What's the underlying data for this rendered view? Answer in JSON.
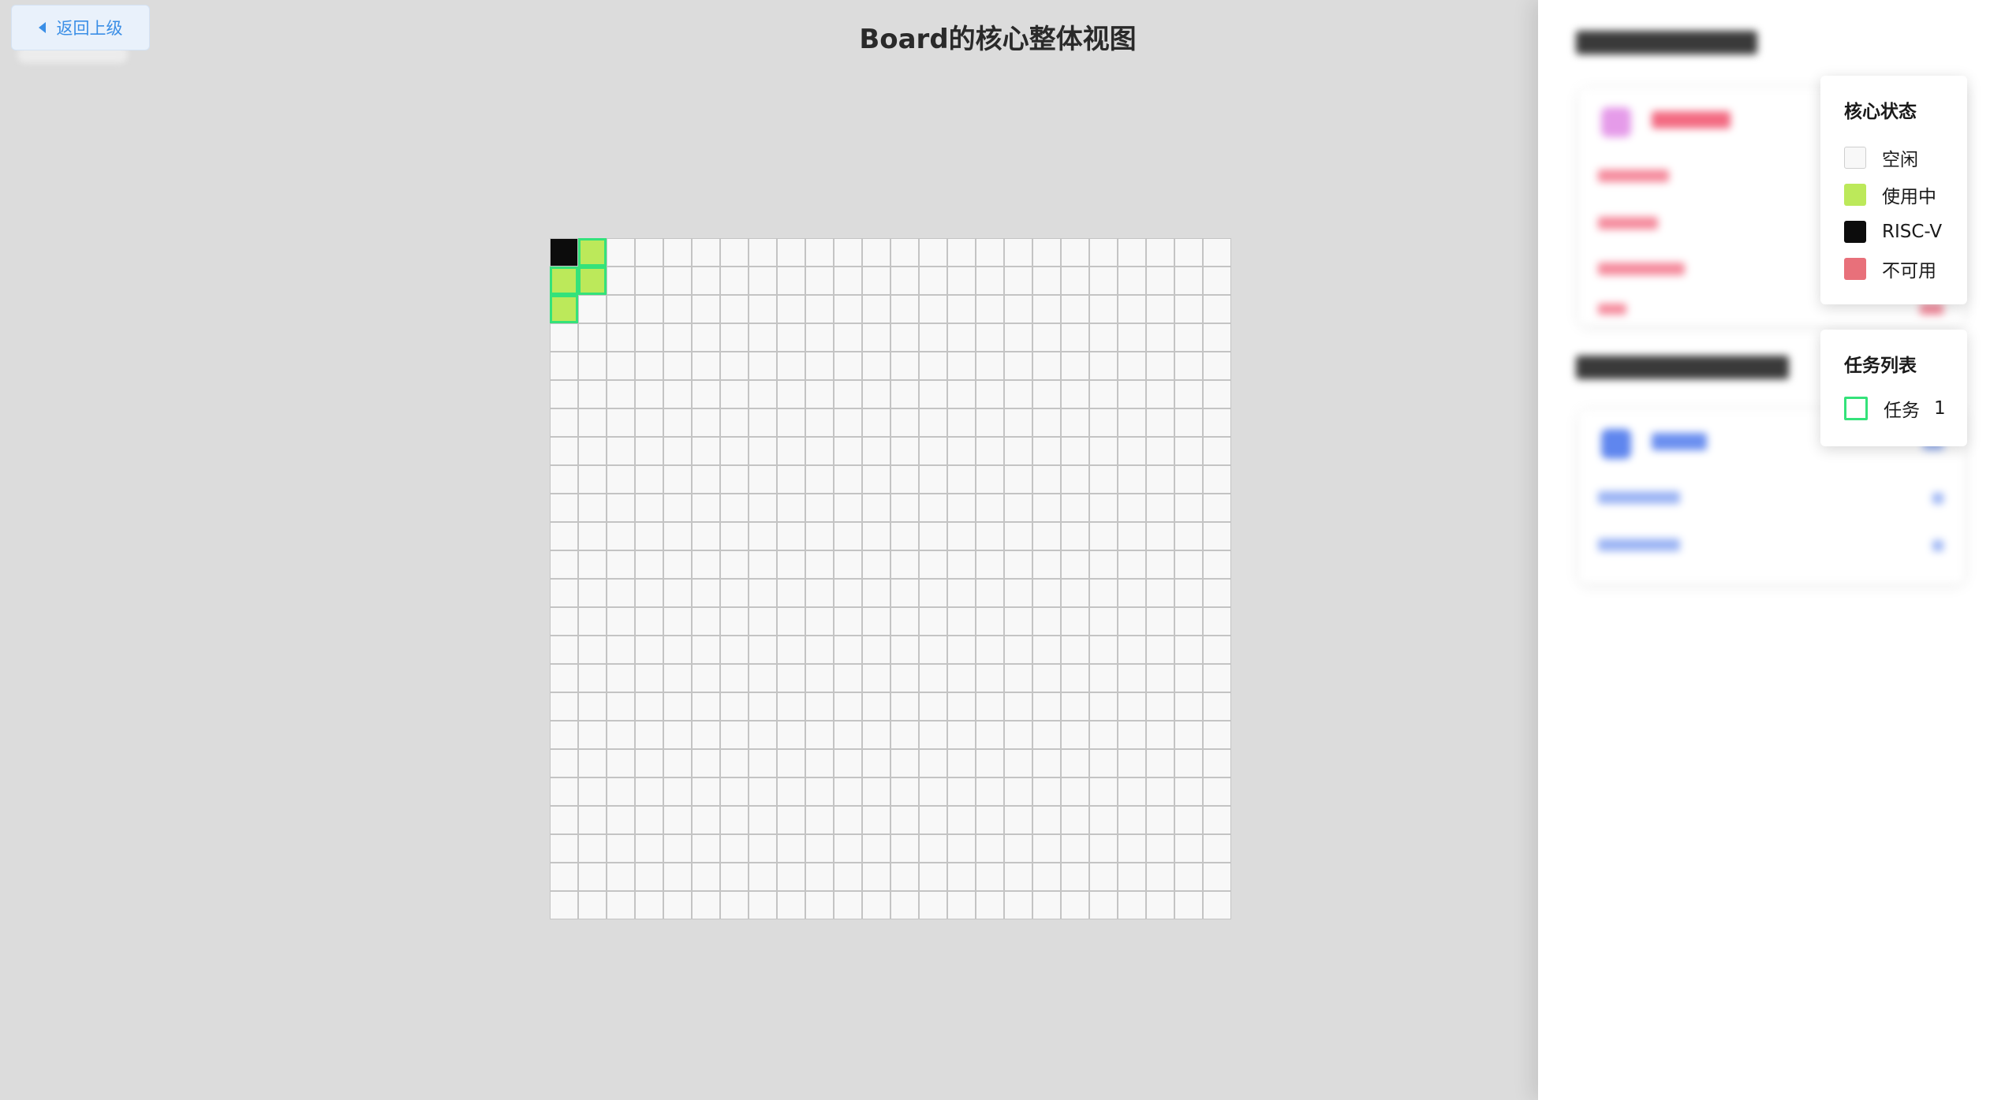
{
  "header": {
    "back_label": "返回上级",
    "title": "Board的核心整体视图"
  },
  "grid": {
    "rows": 24,
    "cols": 24,
    "cells": [
      {
        "row": 0,
        "col": 0,
        "status": "riscv"
      },
      {
        "row": 0,
        "col": 1,
        "status": "busy",
        "task": 1
      },
      {
        "row": 1,
        "col": 0,
        "status": "busy",
        "task": 1
      },
      {
        "row": 1,
        "col": 1,
        "status": "busy",
        "task": 1
      },
      {
        "row": 2,
        "col": 0,
        "status": "busy",
        "task": 1
      }
    ]
  },
  "colors": {
    "idle": "#f8f8f8",
    "busy": "#bce95a",
    "riscv": "#0c0c0c",
    "unavailable": "#e8707a",
    "task_border": "#34e27a"
  },
  "legend": {
    "title": "核心状态",
    "items": [
      {
        "label": "空闲",
        "color": "#f8f8f8",
        "border": "#cfcfcf"
      },
      {
        "label": "使用中",
        "color": "#bce95a",
        "border": "#bce95a"
      },
      {
        "label": "RISC-V",
        "color": "#0c0c0c",
        "border": "#0c0c0c"
      },
      {
        "label": "不可用",
        "color": "#e8707a",
        "border": "#e8707a"
      }
    ]
  },
  "task_legend": {
    "title": "任务列表",
    "items": [
      {
        "label": "任务",
        "count": "1"
      }
    ]
  }
}
